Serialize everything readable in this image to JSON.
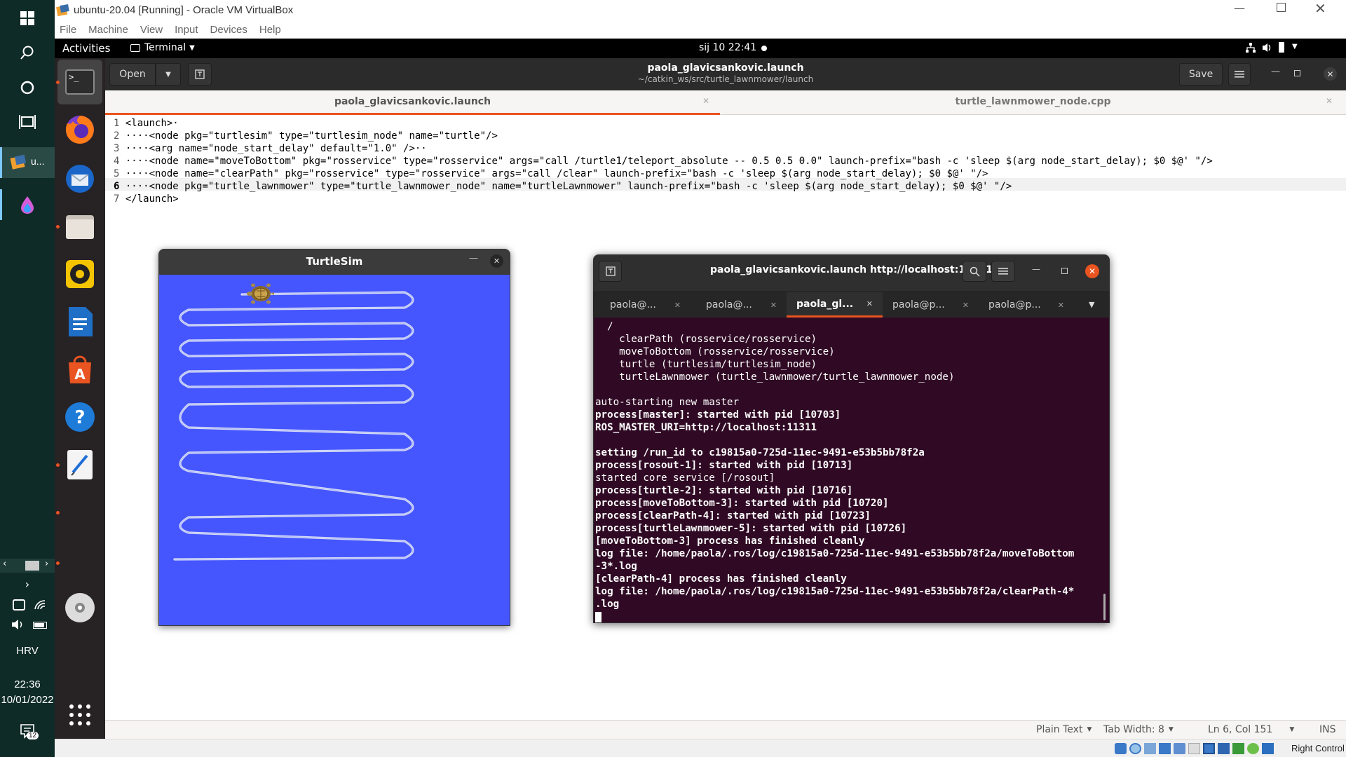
{
  "windows_taskbar": {
    "vbox_task_label": "u...",
    "language": "HRV",
    "time": "22:36",
    "date": "10/01/2022",
    "notification_count": "12"
  },
  "vbox": {
    "title": "ubuntu-20.04 [Running] - Oracle VM VirtualBox",
    "menu": [
      "File",
      "Machine",
      "View",
      "Input",
      "Devices",
      "Help"
    ],
    "host_key": "Right Control"
  },
  "ubuntu_topbar": {
    "activities": "Activities",
    "app_menu": "Terminal",
    "clock": "sij 10  22:41"
  },
  "gedit": {
    "open_label": "Open",
    "save_label": "Save",
    "title": "paola_glavicsankovic.launch",
    "subtitle": "~/catkin_ws/src/turtle_lawnmower/launch",
    "tabs": [
      {
        "label": "paola_glavicsankovic.launch",
        "active": true
      },
      {
        "label": "turtle_lawnmower_node.cpp",
        "active": false
      }
    ],
    "lines": [
      {
        "num": "1",
        "text": "<launch>·"
      },
      {
        "num": "2",
        "text": "····<node pkg=\"turtlesim\" type=\"turtlesim_node\" name=\"turtle\"/>"
      },
      {
        "num": "3",
        "text": "····<arg name=\"node_start_delay\" default=\"1.0\" />··"
      },
      {
        "num": "4",
        "text": "····<node name=\"moveToBottom\" pkg=\"rosservice\" type=\"rosservice\" args=\"call /turtle1/teleport_absolute -- 0.5 0.5 0.0\" launch-prefix=\"bash -c 'sleep $(arg node_start_delay); $0 $@' \"/>"
      },
      {
        "num": "5",
        "text": "····<node name=\"clearPath\" pkg=\"rosservice\" type=\"rosservice\" args=\"call /clear\" launch-prefix=\"bash -c 'sleep $(arg node_start_delay); $0 $@' \"/>"
      },
      {
        "num": "6",
        "text": "····<node pkg=\"turtle_lawnmower\" type=\"turtle_lawnmower_node\" name=\"turtleLawnmower\" launch-prefix=\"bash -c 'sleep $(arg node_start_delay); $0 $@' \"/>"
      },
      {
        "num": "7",
        "text": "</launch>"
      }
    ],
    "status": {
      "language": "Plain Text",
      "tab_width": "Tab Width: 8",
      "position": "Ln 6, Col 151",
      "mode": "INS"
    }
  },
  "turtlesim": {
    "title": "TurtleSim"
  },
  "terminal": {
    "title": "paola_glavicsankovic.launch http://localhost:11311",
    "tabs": [
      {
        "label": "paola@...",
        "active": false
      },
      {
        "label": "paola@...",
        "active": false
      },
      {
        "label": "paola_gl...",
        "active": true
      },
      {
        "label": "paola@p...",
        "active": false
      },
      {
        "label": "paola@p...",
        "active": false
      }
    ],
    "lines": [
      {
        "text": "  /",
        "bold": false
      },
      {
        "text": "    clearPath (rosservice/rosservice)",
        "bold": false
      },
      {
        "text": "    moveToBottom (rosservice/rosservice)",
        "bold": false
      },
      {
        "text": "    turtle (turtlesim/turtlesim_node)",
        "bold": false
      },
      {
        "text": "    turtleLawnmower (turtle_lawnmower/turtle_lawnmower_node)",
        "bold": false
      },
      {
        "text": "",
        "bold": false
      },
      {
        "text": "auto-starting new master",
        "bold": false
      },
      {
        "text": "process[master]: started with pid [10703]",
        "bold": true
      },
      {
        "text": "ROS_MASTER_URI=http://localhost:11311",
        "bold": true
      },
      {
        "text": "",
        "bold": false
      },
      {
        "text": "setting /run_id to c19815a0-725d-11ec-9491-e53b5bb78f2a",
        "bold": true
      },
      {
        "text": "process[rosout-1]: started with pid [10713]",
        "bold": true
      },
      {
        "text": "started core service [/rosout]",
        "bold": false
      },
      {
        "text": "process[turtle-2]: started with pid [10716]",
        "bold": true
      },
      {
        "text": "process[moveToBottom-3]: started with pid [10720]",
        "bold": true
      },
      {
        "text": "process[clearPath-4]: started with pid [10723]",
        "bold": true
      },
      {
        "text": "process[turtleLawnmower-5]: started with pid [10726]",
        "bold": true
      },
      {
        "text": "[moveToBottom-3] process has finished cleanly",
        "bold": true
      },
      {
        "text": "log file: /home/paola/.ros/log/c19815a0-725d-11ec-9491-e53b5bb78f2a/moveToBottom",
        "bold": true
      },
      {
        "text": "-3*.log",
        "bold": true
      },
      {
        "text": "[clearPath-4] process has finished cleanly",
        "bold": true
      },
      {
        "text": "log file: /home/paola/.ros/log/c19815a0-725d-11ec-9491-e53b5bb78f2a/clearPath-4*",
        "bold": true
      },
      {
        "text": ".log",
        "bold": true
      }
    ]
  },
  "colors": {
    "ubuntu_orange": "#e95420",
    "turtlesim_bg": "#4556ff",
    "terminal_bg": "#300a24"
  }
}
